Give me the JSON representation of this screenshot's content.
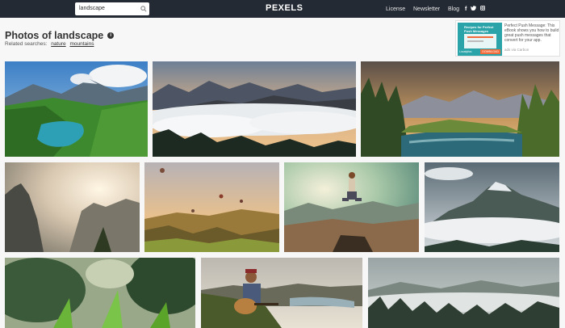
{
  "header": {
    "search_value": "landscape",
    "logo": "PEXELS",
    "nav": {
      "license": "License",
      "newsletter": "Newsletter",
      "blog": "Blog"
    },
    "social": {
      "facebook": "f",
      "twitter": "t",
      "instagram": "i"
    }
  },
  "page": {
    "title": "Photos of landscape",
    "related_label": "Related searches:",
    "related": [
      "nature",
      "mountains"
    ]
  },
  "ad": {
    "image_headline": "Recipes for Perfect Push Messages",
    "image_brand": "Localytics",
    "image_button": "DOWNLOAD",
    "text": "Perfect Push Message: This eBook shows you how to build great push messages that convert for your app.",
    "via": "ads via Carbon"
  },
  "photos": [
    {
      "icon": "lake-mountain-valley-photo"
    },
    {
      "icon": "mountain-fog-sunrise-photo"
    },
    {
      "icon": "river-forest-mountains-photo"
    },
    {
      "icon": "cliff-sunlight-photo"
    },
    {
      "icon": "hot-air-balloons-photo"
    },
    {
      "icon": "man-jumping-photo"
    },
    {
      "icon": "misty-mountain-photo"
    },
    {
      "icon": "grass-closeup-photo"
    },
    {
      "icon": "guitar-player-photo"
    },
    {
      "icon": "foggy-forest-photo"
    }
  ]
}
